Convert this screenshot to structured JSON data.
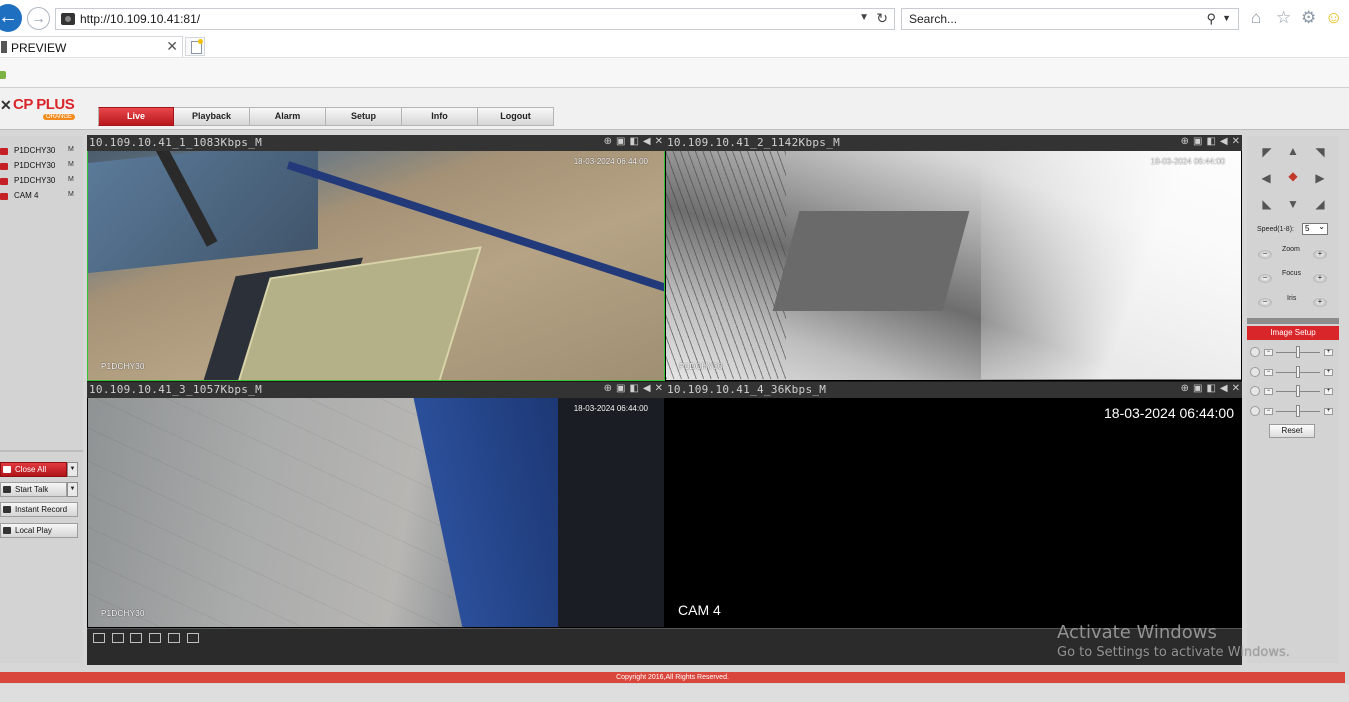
{
  "browser": {
    "url": "http://10.109.10.41:81/",
    "search_placeholder": "Search...",
    "tab_title": "PREVIEW"
  },
  "brand": {
    "logo_text": "CP PLUS",
    "logo_sub": "ORANGE"
  },
  "nav": [
    {
      "label": "Live",
      "active": true
    },
    {
      "label": "Playback",
      "active": false
    },
    {
      "label": "Alarm",
      "active": false
    },
    {
      "label": "Setup",
      "active": false
    },
    {
      "label": "Info",
      "active": false
    },
    {
      "label": "Logout",
      "active": false
    }
  ],
  "channels": [
    {
      "label": "P1DCHY30",
      "stream": "M"
    },
    {
      "label": "P1DCHY30",
      "stream": "M"
    },
    {
      "label": "P1DCHY30",
      "stream": "M"
    },
    {
      "label": "CAM 4",
      "stream": "M"
    }
  ],
  "left_buttons": {
    "close_all": "Close All",
    "start_talk": "Start Talk",
    "instant_record": "Instant Record",
    "local_play": "Local Play"
  },
  "cameras": [
    {
      "title": "10.109.10.41_1_1083Kbps_M",
      "osd_time": "18-03-2024 06:44:00",
      "osd_name": "P1DCHY30"
    },
    {
      "title": "10.109.10.41_2_1142Kbps_M",
      "osd_time": "18-03-2024 06:44:00",
      "osd_name": "P1DCHY30"
    },
    {
      "title": "10.109.10.41_3_1057Kbps_M",
      "osd_time": "18-03-2024 06:44:00",
      "osd_name": "P1DCHY30"
    },
    {
      "title": "10.109.10.41_4_36Kbps_M",
      "osd_time": "18-03-2024 06:44:00",
      "osd_name": "CAM 4"
    }
  ],
  "ptz": {
    "speed_label": "Speed(1-8):",
    "speed_value": "5",
    "zoom": "Zoom",
    "focus": "Focus",
    "iris": "Iris",
    "image_setup": "Image Setup",
    "reset": "Reset",
    "sliders": [
      0.5,
      0.5,
      0.5,
      0.5
    ]
  },
  "footer": {
    "copyright": "Copyright 2016,All Rights Reserved."
  },
  "watermark": {
    "title": "Activate Windows",
    "subtitle": "Go to Settings to activate Windows."
  }
}
